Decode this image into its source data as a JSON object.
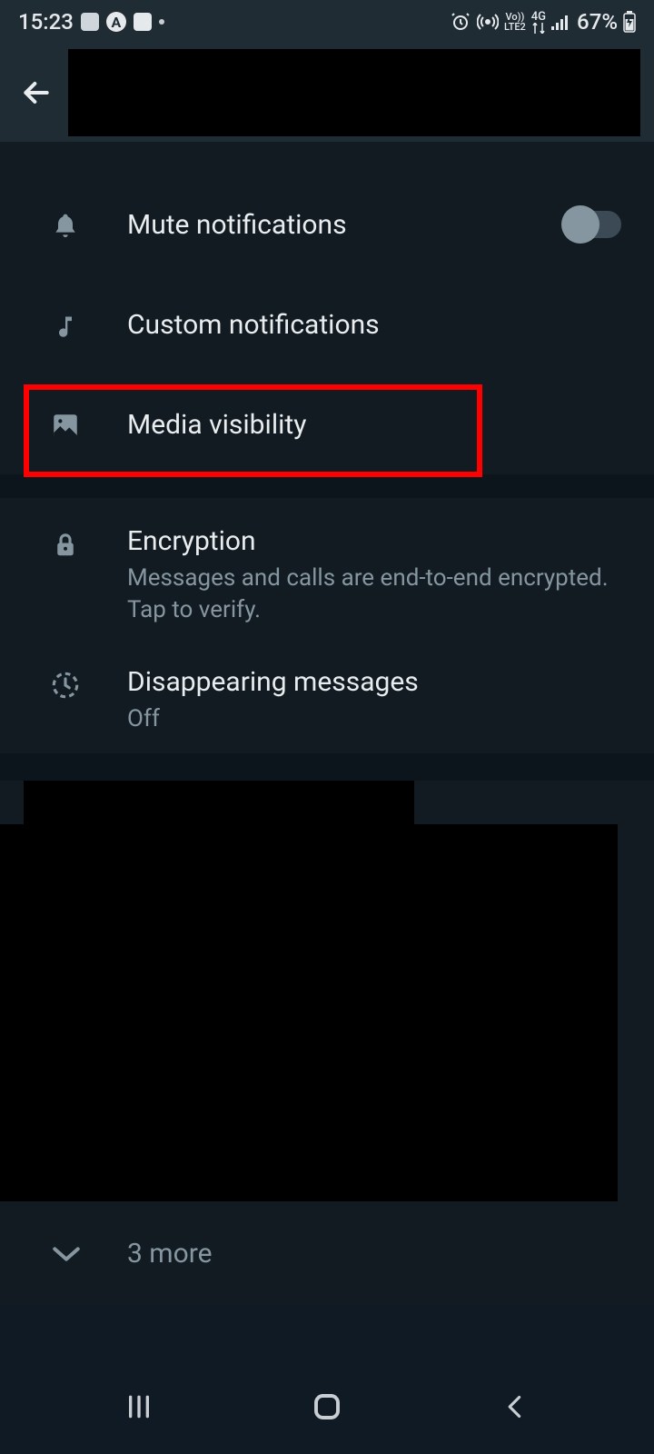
{
  "status": {
    "time": "15:23",
    "battery": "67%",
    "network": "4G",
    "lte": "LTE2",
    "vo": "Vo))"
  },
  "settings": {
    "mute": {
      "label": "Mute notifications",
      "enabled": false
    },
    "custom": {
      "label": "Custom notifications"
    },
    "media": {
      "label": "Media visibility"
    },
    "encryption": {
      "label": "Encryption",
      "sub": "Messages and calls are end-to-end encrypted. Tap to verify."
    },
    "disappearing": {
      "label": "Disappearing messages",
      "sub": "Off"
    }
  },
  "more": {
    "label": "3 more"
  }
}
